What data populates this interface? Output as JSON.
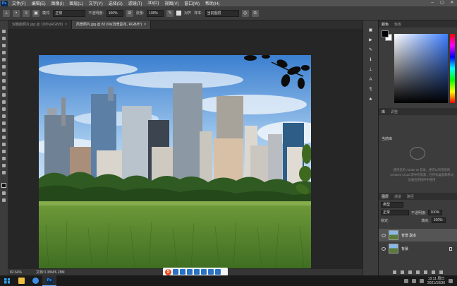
{
  "app": {
    "logo": "Ps"
  },
  "menubar": {
    "items": [
      "文件(F)",
      "编辑(E)",
      "图像(I)",
      "图层(L)",
      "文字(Y)",
      "选择(S)",
      "滤镜(T)",
      "3D(D)",
      "视图(V)",
      "窗口(W)",
      "帮助(H)"
    ]
  },
  "options": {
    "mode_label": "模式:",
    "mode_value": "正常",
    "opacity_label": "不透明度:",
    "opacity_value": "100%",
    "flow_label": "流量:",
    "flow_value": "100%",
    "align_label": "对齐",
    "sample_label": "样本:",
    "sample_value": "当前图层"
  },
  "doc_tabs": [
    {
      "label": "双胞胎照片.jpg @ 100%(RGB/8)",
      "active": false
    },
    {
      "label": "风景照片.jpg @ 82.6%(背景副本, RGB/8*)",
      "active": true
    }
  ],
  "status": {
    "zoom": "82.64%",
    "doc_size": "文档:3.38M/6.28M"
  },
  "panels": {
    "color_tabs": [
      "颜色",
      "色板"
    ],
    "props_tabs": [
      "库",
      "调整"
    ],
    "props_header": "当前库",
    "props_desc": "使用您的 Adobe ID 登录，便可以利用您的 Creative Cloud 库中的资源，在所有桌面和移动设备应用程序中使用",
    "layers_tabs": [
      "图层",
      "通道",
      "路径"
    ],
    "kind_label": "类型",
    "blend_mode": "正常",
    "opacity_label": "不透明度:",
    "opacity_value": "100%",
    "lock_label": "锁定:",
    "fill_label": "填充:",
    "fill_value": "100%",
    "layers": [
      {
        "name": "背景 副本",
        "selected": true,
        "locked": false
      },
      {
        "name": "背景",
        "selected": false,
        "locked": true
      }
    ]
  },
  "taskbar": {
    "time": "13:11 周日",
    "date": "2021/10/30"
  },
  "colors": {
    "foreground": "#000000",
    "background": "#ffffff",
    "accent": "#2aa0f0"
  }
}
